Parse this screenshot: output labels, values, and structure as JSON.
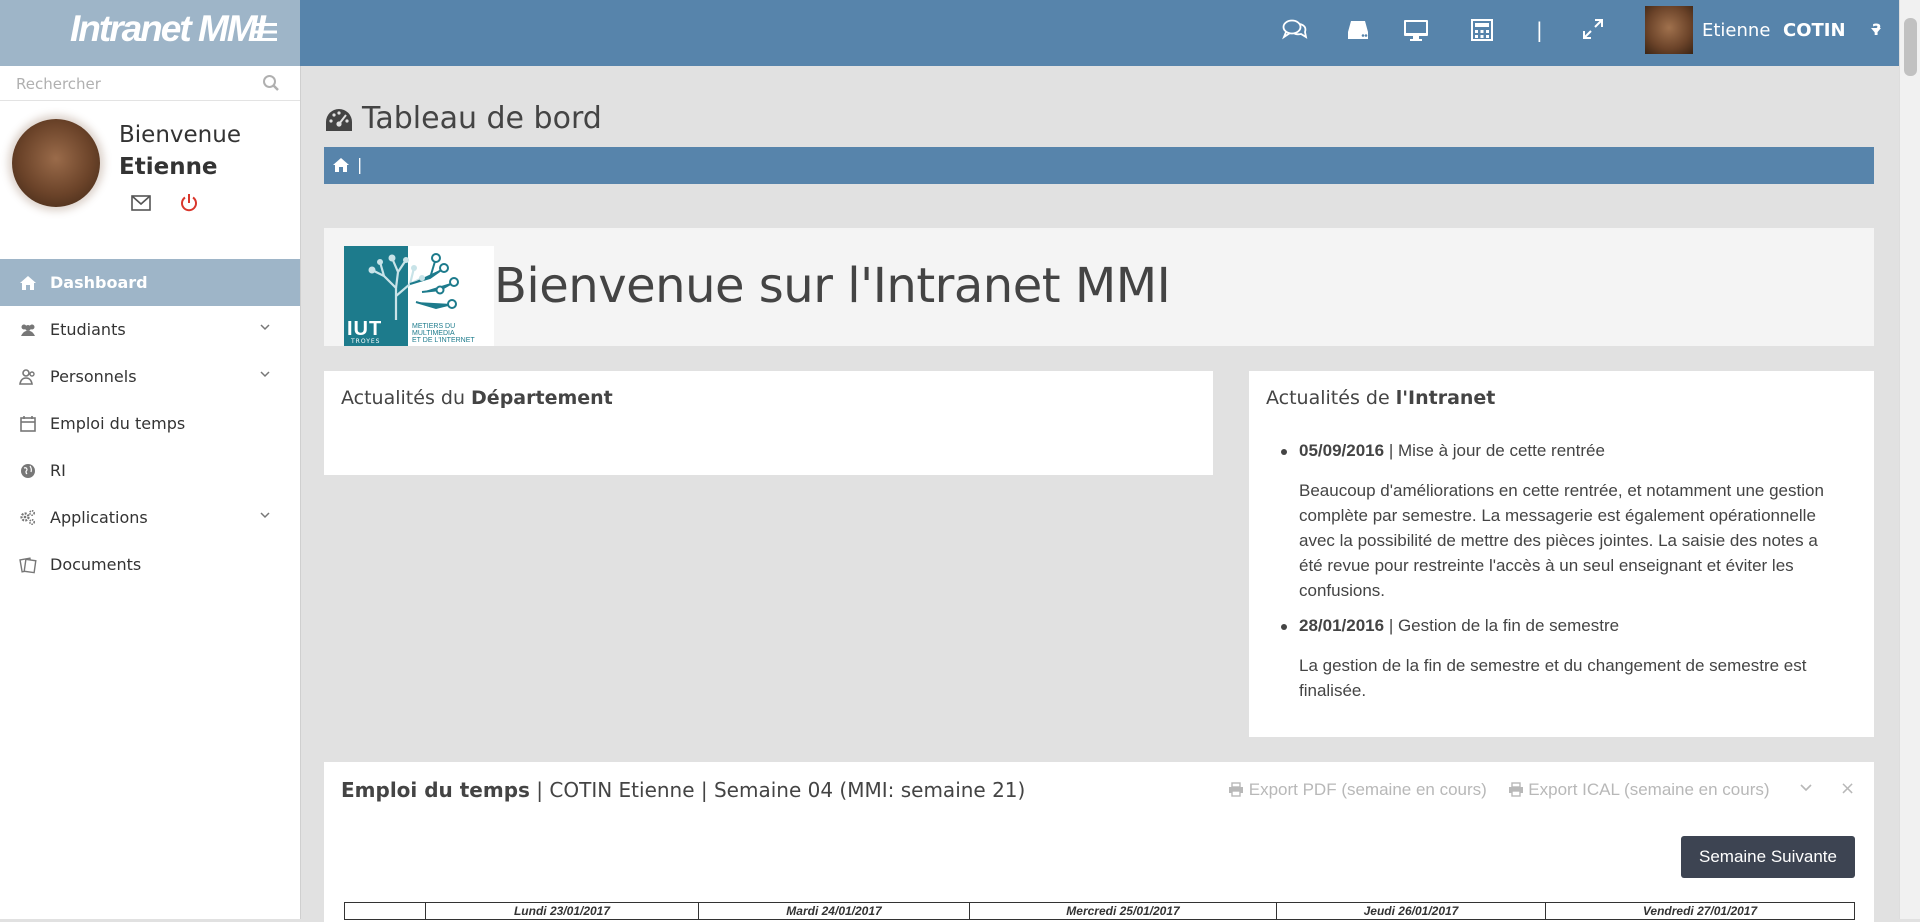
{
  "app": {
    "logo_text": "Intranet MMI"
  },
  "search": {
    "placeholder": "Rechercher"
  },
  "profile": {
    "greeting": "Bienvenue",
    "name": "Etienne"
  },
  "nav": {
    "items": [
      {
        "label": "Dashboard",
        "icon": "home-icon",
        "active": true,
        "has_children": false
      },
      {
        "label": "Etudiants",
        "icon": "users-icon",
        "active": false,
        "has_children": true
      },
      {
        "label": "Personnels",
        "icon": "user-group-icon",
        "active": false,
        "has_children": true
      },
      {
        "label": "Emploi du temps",
        "icon": "calendar-icon",
        "active": false,
        "has_children": false
      },
      {
        "label": "RI",
        "icon": "globe-icon",
        "active": false,
        "has_children": false
      },
      {
        "label": "Applications",
        "icon": "cogs-icon",
        "active": false,
        "has_children": true
      },
      {
        "label": "Documents",
        "icon": "documents-icon",
        "active": false,
        "has_children": false
      }
    ]
  },
  "topbar": {
    "icons": [
      "comments-icon",
      "drive-icon",
      "desktop-icon",
      "calculator-icon",
      "fullscreen-icon"
    ],
    "separator": "|",
    "user_first": "Etienne",
    "user_last": "COTIN",
    "help": "?"
  },
  "page": {
    "title": "Tableau de bord",
    "breadcrumb_sep": "|"
  },
  "banner": {
    "title": "Bienvenue sur l'Intranet MMI",
    "logo_text": "IUT",
    "logo_sub": "TROYES",
    "logo_line1": "Metiers du",
    "logo_line2": "Multimedia",
    "logo_line3": "et de l'Internet"
  },
  "panels": {
    "dept": {
      "title_prefix": "Actualités du",
      "title_bold": "Département"
    },
    "intranet": {
      "title_prefix": "Actualités de",
      "title_bold": "l'Intranet",
      "news": [
        {
          "date": "05/09/2016",
          "title": " | Mise à jour de cette rentrée",
          "body": "Beaucoup d'améliorations en cette rentrée, et notamment une gestion complète par semestre. La messagerie est également opérationnelle avec la possibilité de mettre des pièces jointes. La saisie des notes a été revue pour restreinte l'accès à un seul enseignant et éviter les confusions."
        },
        {
          "date": "28/01/2016",
          "title": " | Gestion de la fin de semestre",
          "body": "La gestion de la fin de semestre et du changement de semestre est finalisée."
        }
      ]
    }
  },
  "edt": {
    "title_bold": "Emploi du temps",
    "title_rest": " | COTIN Etienne | Semaine 04 (MMI: semaine 21)",
    "export_pdf": "Export PDF (semaine en cours)",
    "export_ical": "Export ICAL (semaine en cours)",
    "close": "×",
    "next_button": "Semaine Suivante",
    "days": [
      "",
      "Lundi 23/01/2017",
      "Mardi 24/01/2017",
      "Mercredi 25/01/2017",
      "Jeudi 26/01/2017",
      "Vendredi 27/01/2017"
    ]
  },
  "colors": {
    "topbar": "#5784ab",
    "sidebar_active": "#9eb5c8",
    "button_dark": "#3d4452",
    "logout_red": "#d9362b"
  }
}
